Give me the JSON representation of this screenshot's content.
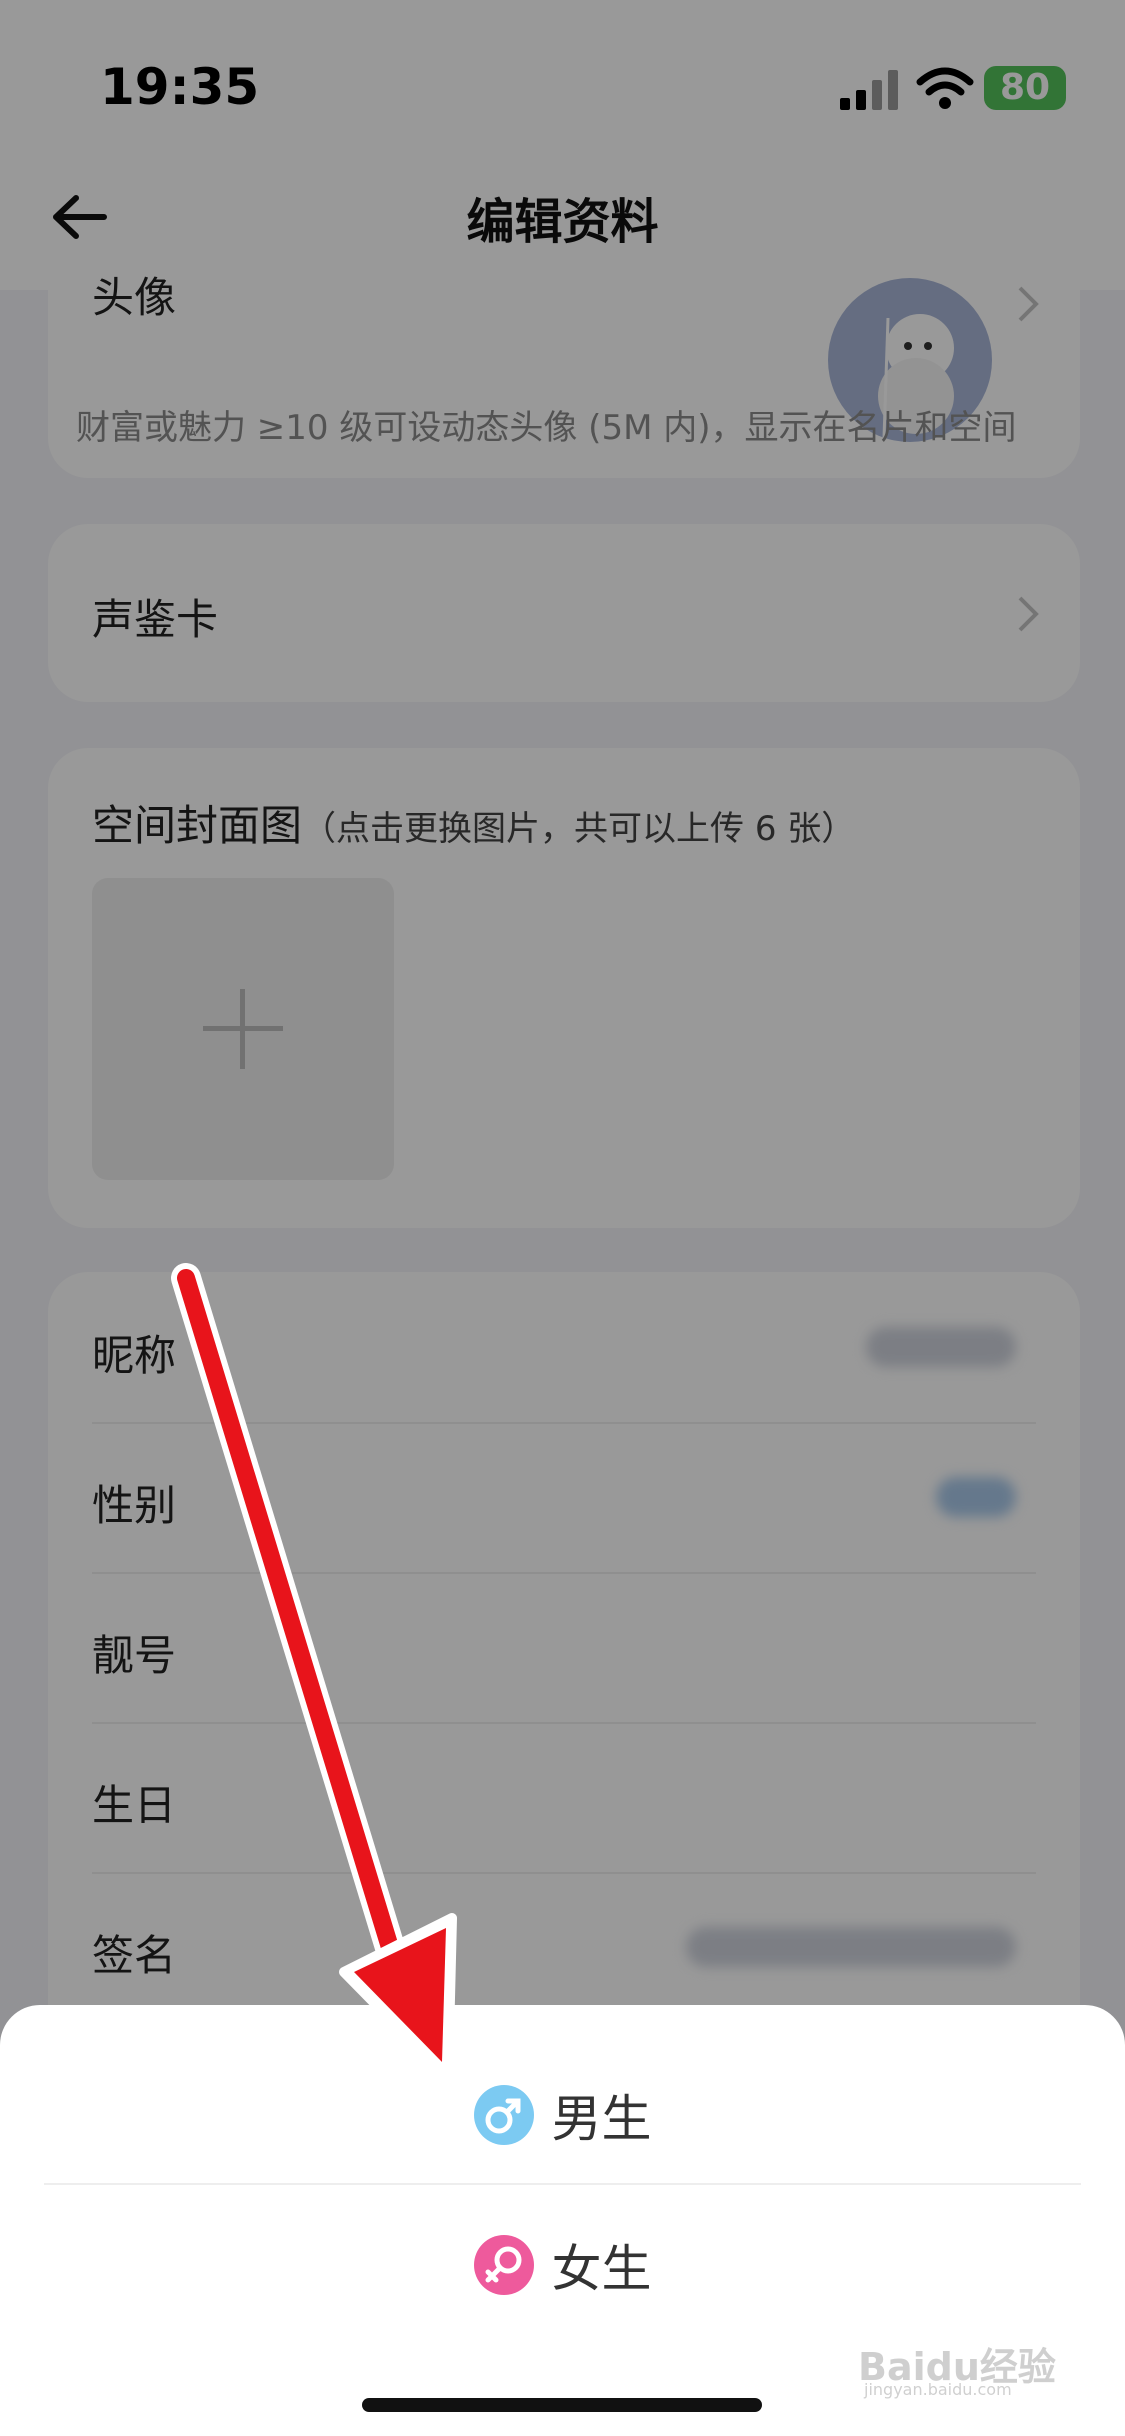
{
  "status": {
    "time": "19:35",
    "battery": "80"
  },
  "nav": {
    "title": "编辑资料"
  },
  "avatar_card": {
    "label": "头像",
    "hint": "财富或魅力 ≥10 级可设动态头像 (5M 内)，显示在名片和空间"
  },
  "voice_card": {
    "label": "声鉴卡"
  },
  "cover_card": {
    "title": "空间封面图",
    "subtitle": "（点击更换图片，共可以上传 6 张）"
  },
  "info_rows": [
    "昵称",
    "性别",
    "靓号",
    "生日",
    "签名"
  ],
  "sheet": {
    "male": "男生",
    "female": "女生"
  },
  "watermark": {
    "brand": "Baidu经验",
    "url": "jingyan.baidu.com"
  },
  "colors": {
    "male": "#7ccaf2",
    "female": "#ee5a9c",
    "arrow": "#e8141b"
  }
}
